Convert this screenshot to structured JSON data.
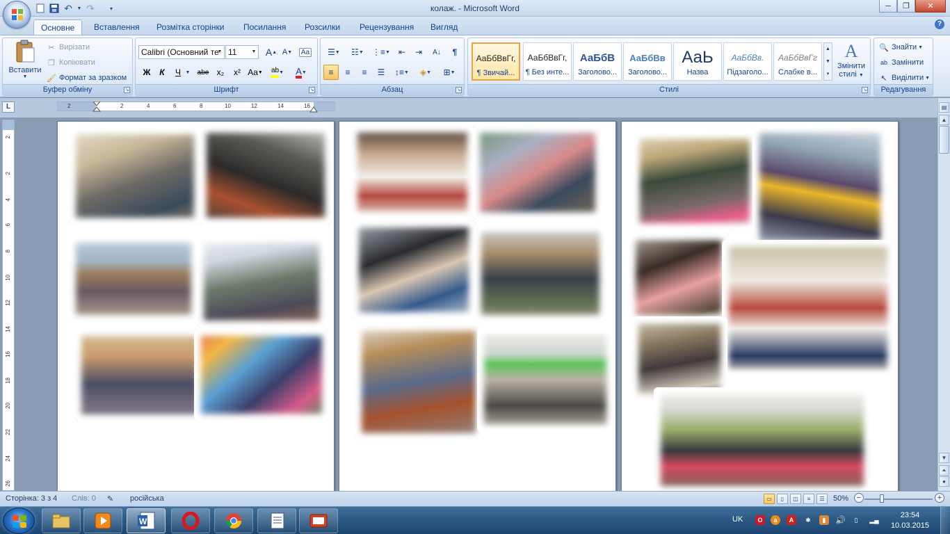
{
  "window": {
    "title": "колаж. - Microsoft Word",
    "minimize": "─",
    "maximize": "❐",
    "close": "✕"
  },
  "quick_access": {
    "save_icon": "save-icon",
    "undo_icon": "undo-icon",
    "redo_icon": "redo-icon"
  },
  "tabs": [
    "Основне",
    "Вставлення",
    "Розмітка сторінки",
    "Посилання",
    "Розсилки",
    "Рецензування",
    "Вигляд"
  ],
  "active_tab": "Основне",
  "ribbon": {
    "clipboard": {
      "label": "Буфер обміну",
      "paste": "Вставити",
      "cut": "Вирізати",
      "copy": "Копіювати",
      "format_painter": "Формат за зразком"
    },
    "font": {
      "label": "Шрифт",
      "font_name": "Calibri (Основний те",
      "font_size": "11",
      "grow": "A",
      "shrink": "A",
      "bold": "Ж",
      "italic": "К",
      "underline": "Ч",
      "strike": "abe",
      "subscript": "x₂",
      "superscript": "x²",
      "change_case": "Aa",
      "highlight": "ab",
      "font_color": "A"
    },
    "paragraph": {
      "label": "Абзац",
      "pilcrow": "¶"
    },
    "styles": {
      "label": "Стилі",
      "items": [
        {
          "sample": "АаБбВвГг,",
          "name": "¶ Звичай..."
        },
        {
          "sample": "АаБбВвГг,",
          "name": "¶ Без инте..."
        },
        {
          "sample": "АаБбВ",
          "name": "Заголово..."
        },
        {
          "sample": "АаБбВв",
          "name": "Заголово..."
        },
        {
          "sample": "АаЬ",
          "name": "Назва"
        },
        {
          "sample": "АаБбВв.",
          "name": "Підзаголо..."
        },
        {
          "sample": "АаБбВвГг",
          "name": "Слабке в..."
        }
      ],
      "change_styles_line1": "Змінити",
      "change_styles_line2": "стилі"
    },
    "editing": {
      "label": "Редагування",
      "find": "Знайти",
      "replace": "Замінити",
      "select": "Виділити"
    }
  },
  "ruler": {
    "h_ticks": [
      "2",
      "2",
      "4",
      "6",
      "8",
      "10",
      "12",
      "14",
      "16"
    ],
    "v_ticks": [
      "2",
      "2",
      "4",
      "6",
      "8",
      "10",
      "12",
      "14",
      "16",
      "18",
      "20",
      "22",
      "24",
      "26"
    ]
  },
  "statusbar": {
    "page": "Сторінка: 3 з 4",
    "words": "Слів: 0",
    "language": "російська",
    "zoom": "50%",
    "zoom_out": "−",
    "zoom_in": "+"
  },
  "taskbar": {
    "language": "UK",
    "time": "23:54",
    "date": "10.03.2015"
  }
}
